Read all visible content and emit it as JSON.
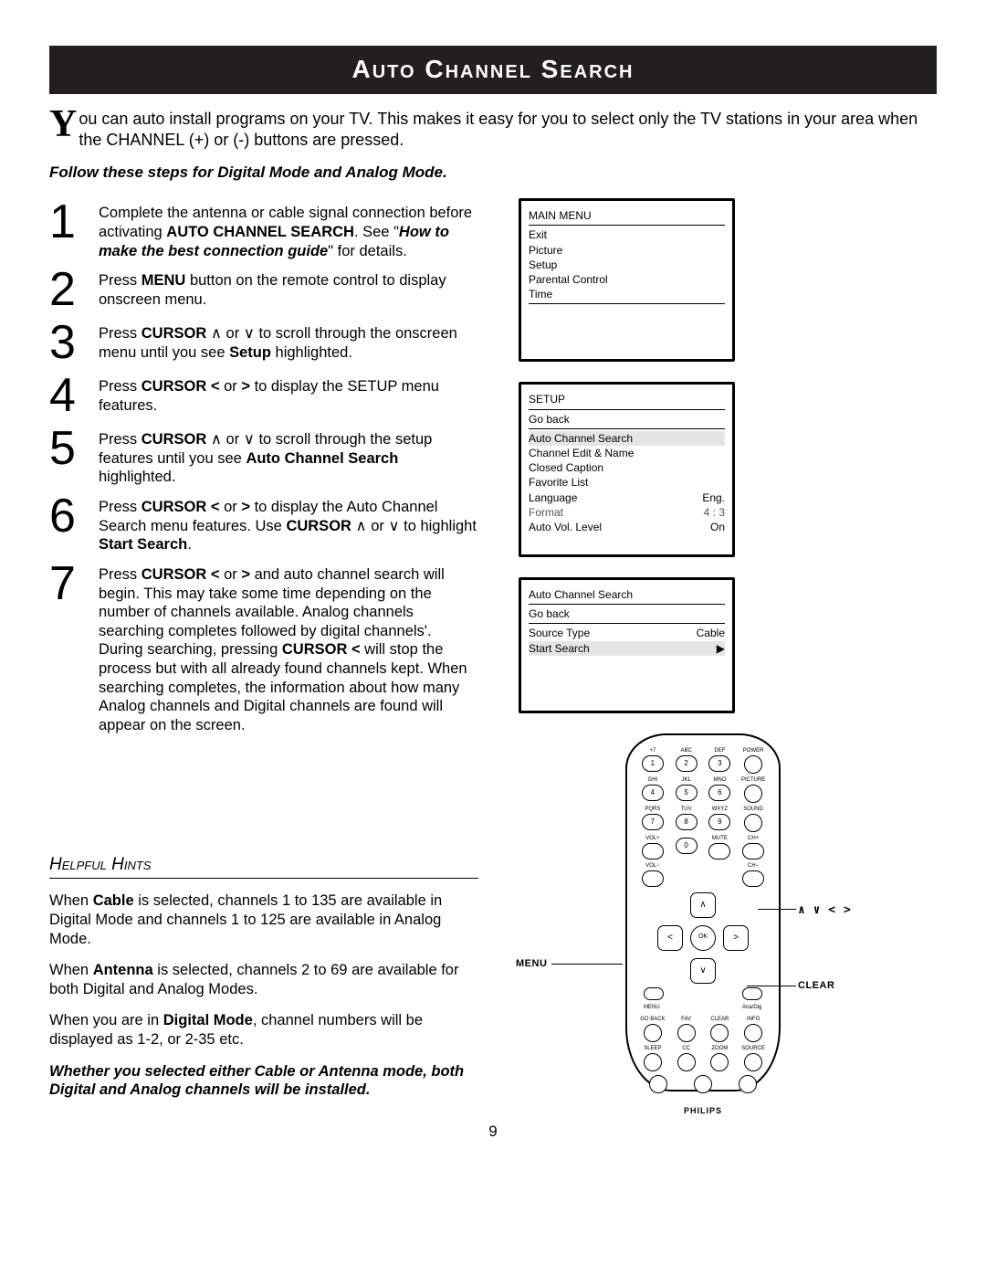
{
  "title": "Auto Channel Search",
  "intro_dropcap": "Y",
  "intro_rest": "ou can auto install programs on your TV.  This makes it easy for you to select only the TV stations in your area when the CHANNEL (+) or (-) buttons are pressed.",
  "subhead": "Follow these steps for Digital Mode and Analog Mode.",
  "steps": [
    {
      "n": "1",
      "html": "Complete the antenna or cable signal connection before activating <b>AUTO CHANNEL SEARCH</b>. See \"<b><i>How to make the best connection guide</i></b>\" for details."
    },
    {
      "n": "2",
      "html": "Press <b>MENU</b> button on the remote control to display onscreen menu."
    },
    {
      "n": "3",
      "html": "Press <b>CURSOR</b> ∧ or ∨ to scroll through the onscreen menu until you see <b>Setup</b> highlighted."
    },
    {
      "n": "4",
      "html": "Press <b>CURSOR &lt;</b> or <b>&gt;</b> to display the SETUP menu features."
    },
    {
      "n": "5",
      "html": "Press <b>CURSOR</b> ∧ or ∨ to scroll through the setup features until you see <b>Auto Channel Search</b> highlighted."
    },
    {
      "n": "6",
      "html": "Press <b>CURSOR &lt;</b> or <b>&gt;</b> to display the Auto Channel Search menu features. Use <b>CURSOR</b> ∧ or ∨ to highlight <b>Start Search</b>."
    },
    {
      "n": "7",
      "html": "Press <b>CURSOR &lt;</b> or <b>&gt;</b> and auto channel search will begin.  This may take some time depending on the number of channels available.  Analog channels searching completes followed by digital channels'.  During searching, pressing <b>CURSOR &lt;</b> will stop the process but with all already found channels kept.  When searching completes, the information about how many Analog channels and Digital channels are found will appear on the screen."
    }
  ],
  "hints_title": "Helpful Hints",
  "hints": [
    "When <b>Cable</b> is selected, channels 1 to 135 are available in Digital Mode and channels 1 to 125 are available in Analog Mode.",
    "When <b>Antenna</b> is selected, channels 2 to 69 are available for both Digital and Analog Modes.",
    "When you are in <b>Digital Mode</b>, channel numbers will be displayed as 1-2, or 2-35 etc."
  ],
  "hints_final": "Whether you selected either Cable or Antenna mode, both Digital and Analog channels will be installed.",
  "osd1": {
    "title": "MAIN MENU",
    "items": [
      "Exit",
      "Picture",
      "Setup",
      "Parental Control",
      "Time"
    ]
  },
  "osd2": {
    "title": "SETUP",
    "goback": "Go back",
    "rows": [
      {
        "l": "Auto Channel Search",
        "r": "",
        "hl": true
      },
      {
        "l": "Channel Edit & Name",
        "r": ""
      },
      {
        "l": "Closed Caption",
        "r": ""
      },
      {
        "l": "Favorite List",
        "r": ""
      },
      {
        "l": "Language",
        "r": "Eng."
      },
      {
        "l": "Format",
        "r": "4 : 3",
        "sub": true
      },
      {
        "l": "Auto Vol. Level",
        "r": "On"
      }
    ]
  },
  "osd3": {
    "title": "Auto Channel Search",
    "goback": "Go back",
    "rows": [
      {
        "l": "Source Type",
        "r": "Cable"
      },
      {
        "l": "Start Search",
        "r": "▶",
        "hl": true
      }
    ]
  },
  "remote": {
    "row1_lbl": [
      "+7",
      "ABC",
      "DEF",
      "POWER"
    ],
    "row1": [
      "1",
      "2",
      "3",
      ""
    ],
    "row2_lbl": [
      "GHI",
      "JKL",
      "MNO",
      "PICTURE"
    ],
    "row2": [
      "4",
      "5",
      "6",
      ""
    ],
    "row3_lbl": [
      "PQRS",
      "TUV",
      "WXYZ",
      "SOUND"
    ],
    "row3": [
      "7",
      "8",
      "9",
      ""
    ],
    "row4_lbl": [
      "VOL+",
      "",
      "MUTE",
      "CH+"
    ],
    "row4": [
      "",
      "0",
      "",
      ""
    ],
    "row5_lbl": [
      "VOL−",
      "",
      "",
      "CH−"
    ],
    "up": "∧",
    "down": "∨",
    "left": "<",
    "right": ">",
    "ok": "OK",
    "menu": "MENU",
    "anadig": "Ana/Dig",
    "row6_lbl": [
      "GO BACK",
      "FAV",
      "CLEAR",
      "INFO"
    ],
    "row7_lbl": [
      "SLEEP",
      "CC",
      "ZOOM",
      "SOURCE"
    ],
    "brand": "PHILIPS"
  },
  "callouts": {
    "menu": "MENU",
    "cursor": "∧ ∨ < >",
    "clear": "CLEAR"
  },
  "page_num": "9"
}
